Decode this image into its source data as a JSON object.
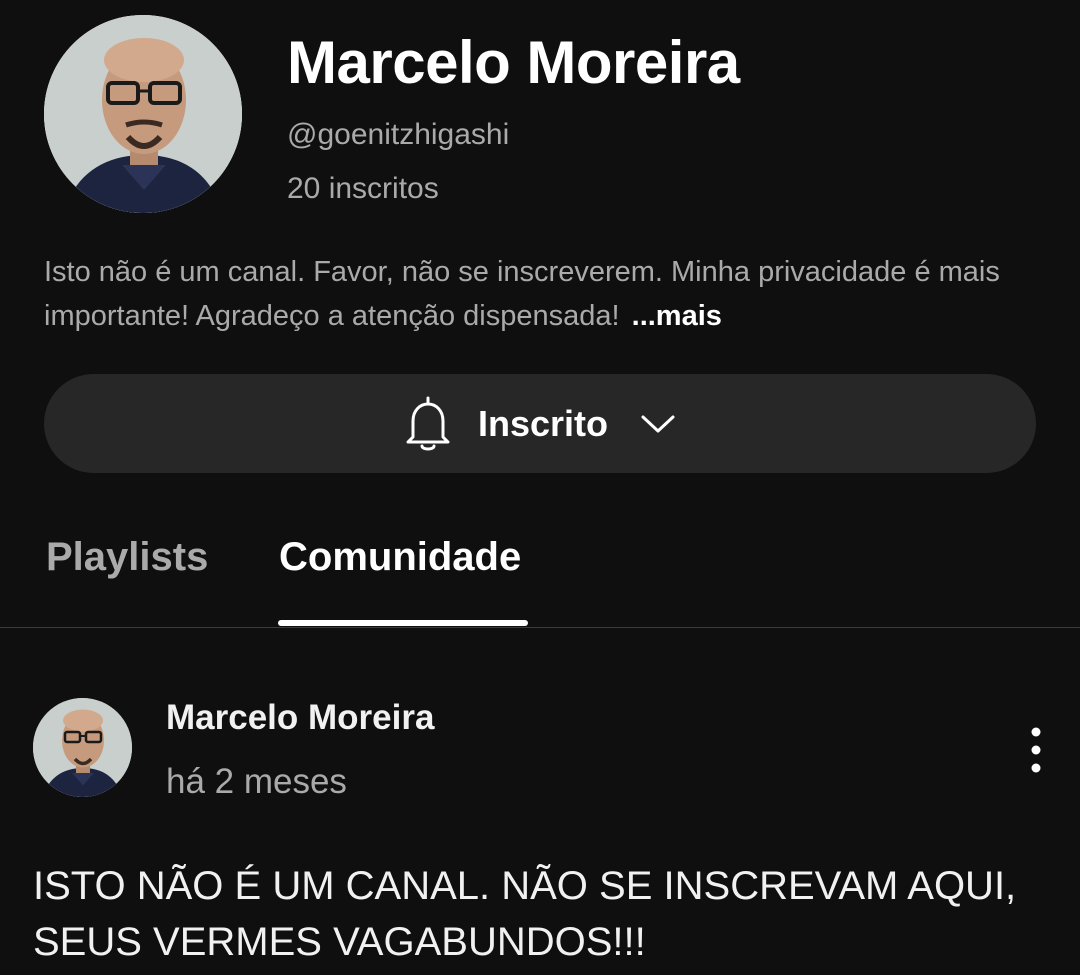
{
  "channel": {
    "name": "Marcelo Moreira",
    "handle": "@goenitzhigashi",
    "subscribers": "20 inscritos",
    "description": "Isto não é um canal. Favor, não se inscreverem. Minha privacidade é mais importante! Agradeço a atenção dispensada!",
    "more_label": "...mais",
    "avatar_icon": "profile-photo"
  },
  "subscribe": {
    "label": "Inscrito",
    "bell_icon": "bell-icon",
    "dropdown_icon": "chevron-down-icon"
  },
  "tabs": [
    {
      "label": "Playlists",
      "active": false
    },
    {
      "label": "Comunidade",
      "active": true
    }
  ],
  "post": {
    "author": "Marcelo Moreira",
    "time": "há 2 meses",
    "menu_icon": "more-vertical-icon",
    "text": "ISTO NÃO É UM CANAL. NÃO SE INSCREVAM AQUI, SEUS VERMES VAGABUNDOS!!!"
  },
  "colors": {
    "background": "#0f0f0f",
    "button_background": "#272727",
    "primary_text": "#f1f1f1",
    "secondary_text": "#aaaaaa"
  }
}
